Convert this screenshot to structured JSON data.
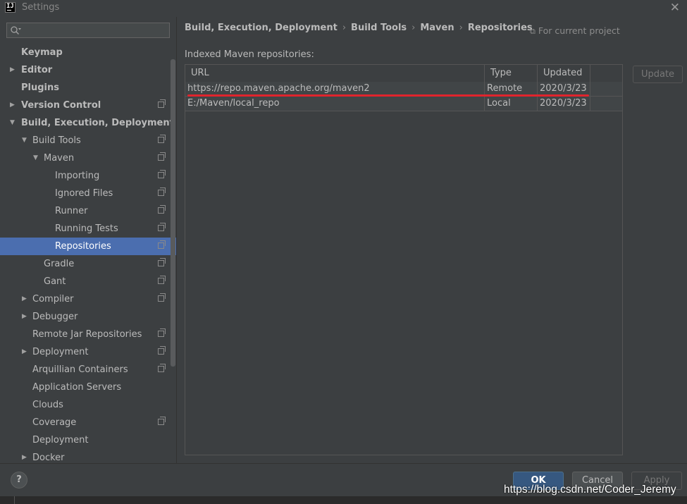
{
  "window": {
    "title": "Settings"
  },
  "sidebar": {
    "search_placeholder": "",
    "items": [
      {
        "label": "Keymap",
        "level": 0,
        "bold": true,
        "arrow": "",
        "proj": false,
        "selected": false
      },
      {
        "label": "Editor",
        "level": 0,
        "bold": true,
        "arrow": "collapsed",
        "proj": false,
        "selected": false
      },
      {
        "label": "Plugins",
        "level": 0,
        "bold": true,
        "arrow": "",
        "proj": false,
        "selected": false
      },
      {
        "label": "Version Control",
        "level": 0,
        "bold": true,
        "arrow": "collapsed",
        "proj": true,
        "selected": false
      },
      {
        "label": "Build, Execution, Deployment",
        "level": 0,
        "bold": true,
        "arrow": "expanded",
        "proj": false,
        "selected": false
      },
      {
        "label": "Build Tools",
        "level": 1,
        "bold": false,
        "arrow": "expanded",
        "proj": true,
        "selected": false
      },
      {
        "label": "Maven",
        "level": 2,
        "bold": false,
        "arrow": "expanded",
        "proj": true,
        "selected": false
      },
      {
        "label": "Importing",
        "level": 3,
        "bold": false,
        "arrow": "",
        "proj": true,
        "selected": false
      },
      {
        "label": "Ignored Files",
        "level": 3,
        "bold": false,
        "arrow": "",
        "proj": true,
        "selected": false
      },
      {
        "label": "Runner",
        "level": 3,
        "bold": false,
        "arrow": "",
        "proj": true,
        "selected": false
      },
      {
        "label": "Running Tests",
        "level": 3,
        "bold": false,
        "arrow": "",
        "proj": true,
        "selected": false
      },
      {
        "label": "Repositories",
        "level": 3,
        "bold": false,
        "arrow": "",
        "proj": true,
        "selected": true
      },
      {
        "label": "Gradle",
        "level": 2,
        "bold": false,
        "arrow": "",
        "proj": true,
        "selected": false
      },
      {
        "label": "Gant",
        "level": 2,
        "bold": false,
        "arrow": "",
        "proj": true,
        "selected": false
      },
      {
        "label": "Compiler",
        "level": 1,
        "bold": false,
        "arrow": "collapsed",
        "proj": true,
        "selected": false
      },
      {
        "label": "Debugger",
        "level": 1,
        "bold": false,
        "arrow": "collapsed",
        "proj": false,
        "selected": false
      },
      {
        "label": "Remote Jar Repositories",
        "level": 1,
        "bold": false,
        "arrow": "",
        "proj": true,
        "selected": false
      },
      {
        "label": "Deployment",
        "level": 1,
        "bold": false,
        "arrow": "collapsed",
        "proj": true,
        "selected": false
      },
      {
        "label": "Arquillian Containers",
        "level": 1,
        "bold": false,
        "arrow": "",
        "proj": true,
        "selected": false
      },
      {
        "label": "Application Servers",
        "level": 1,
        "bold": false,
        "arrow": "",
        "proj": false,
        "selected": false
      },
      {
        "label": "Clouds",
        "level": 1,
        "bold": false,
        "arrow": "",
        "proj": false,
        "selected": false
      },
      {
        "label": "Coverage",
        "level": 1,
        "bold": false,
        "arrow": "",
        "proj": true,
        "selected": false
      },
      {
        "label": "Deployment",
        "level": 1,
        "bold": false,
        "arrow": "",
        "proj": false,
        "selected": false
      },
      {
        "label": "Docker",
        "level": 1,
        "bold": false,
        "arrow": "collapsed",
        "proj": false,
        "selected": false
      }
    ]
  },
  "breadcrumb": [
    "Build, Execution, Deployment",
    "Build Tools",
    "Maven",
    "Repositories"
  ],
  "for_current_project": "For current project",
  "section_label": "Indexed Maven repositories:",
  "table": {
    "columns": [
      "URL",
      "Type",
      "Updated"
    ],
    "rows": [
      {
        "url": "https://repo.maven.apache.org/maven2",
        "type": "Remote",
        "updated": "2020/3/23"
      },
      {
        "url": "E:/Maven/local_repo",
        "type": "Local",
        "updated": "2020/3/23"
      }
    ]
  },
  "buttons": {
    "update": "Update",
    "ok": "OK",
    "cancel": "Cancel",
    "apply": "Apply",
    "help": "?"
  },
  "watermark": "https://blog.csdn.net/Coder_Jeremy",
  "colors": {
    "background": "#3c3f41",
    "selection": "#4b6eaf",
    "primary_button": "#365880",
    "annotation": "#e0242d"
  },
  "icons": {
    "search": "search-icon",
    "project_scope": "project-scope-icon",
    "close": "close-icon"
  }
}
